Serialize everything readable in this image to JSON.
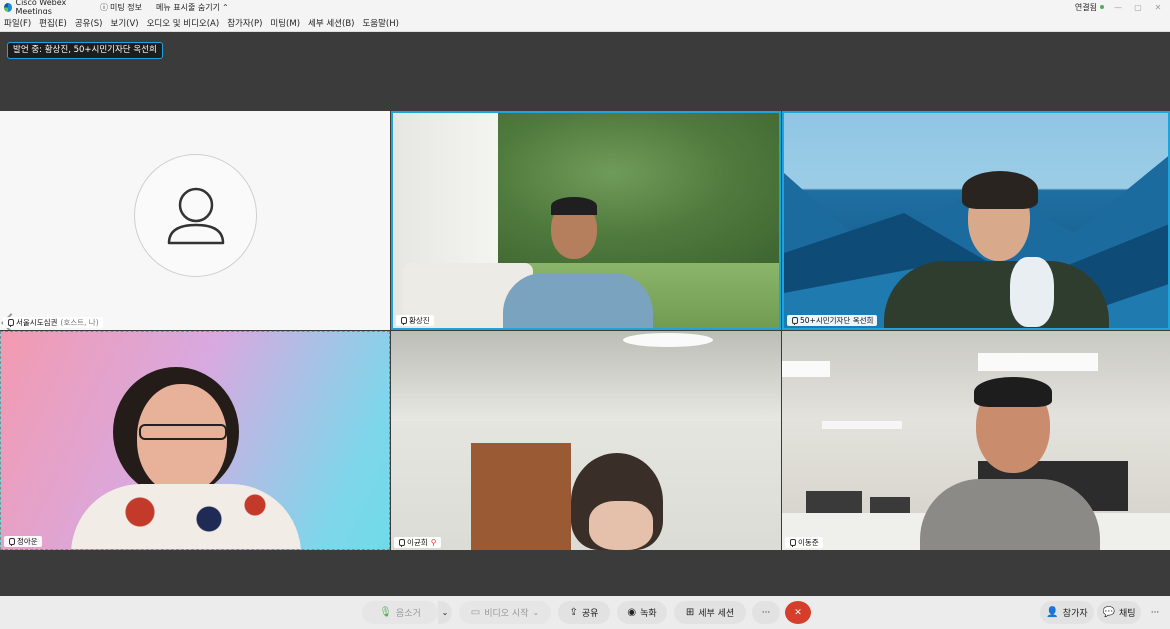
{
  "titlebar": {
    "app_name": "Cisco Webex Meetings",
    "meeting_info": "미팅 정보",
    "hide_menu": "메뉴 표시줄 숨기기",
    "connection": "연결됨"
  },
  "menu": {
    "items": [
      "파일(F)",
      "편집(E)",
      "공유(S)",
      "보기(V)",
      "오디오 및 비디오(A)",
      "참가자(P)",
      "미팅(M)",
      "세부 세션(B)",
      "도움말(H)"
    ]
  },
  "speaking": "발언 중: 황상진, 50+시민기자단 옥선희",
  "participants": [
    {
      "name": "서울시도심권",
      "sub": "(호스트, 나)"
    },
    {
      "name": "황상진"
    },
    {
      "name": "50+시민기자단 옥선희"
    },
    {
      "name": "정아운"
    },
    {
      "name": "이균희",
      "muted": true
    },
    {
      "name": "이동준"
    }
  ],
  "toolbar": {
    "mute": "음소거",
    "video": "비디오 시작",
    "share": "공유",
    "record": "녹화",
    "breakout": "세부 세션",
    "more": "···",
    "end": "✕",
    "participants": "참가자",
    "chat": "채팅"
  },
  "colors": {
    "accent": "#1ea4d9",
    "end_call": "#d43e2a",
    "connected": "#4cb050"
  }
}
